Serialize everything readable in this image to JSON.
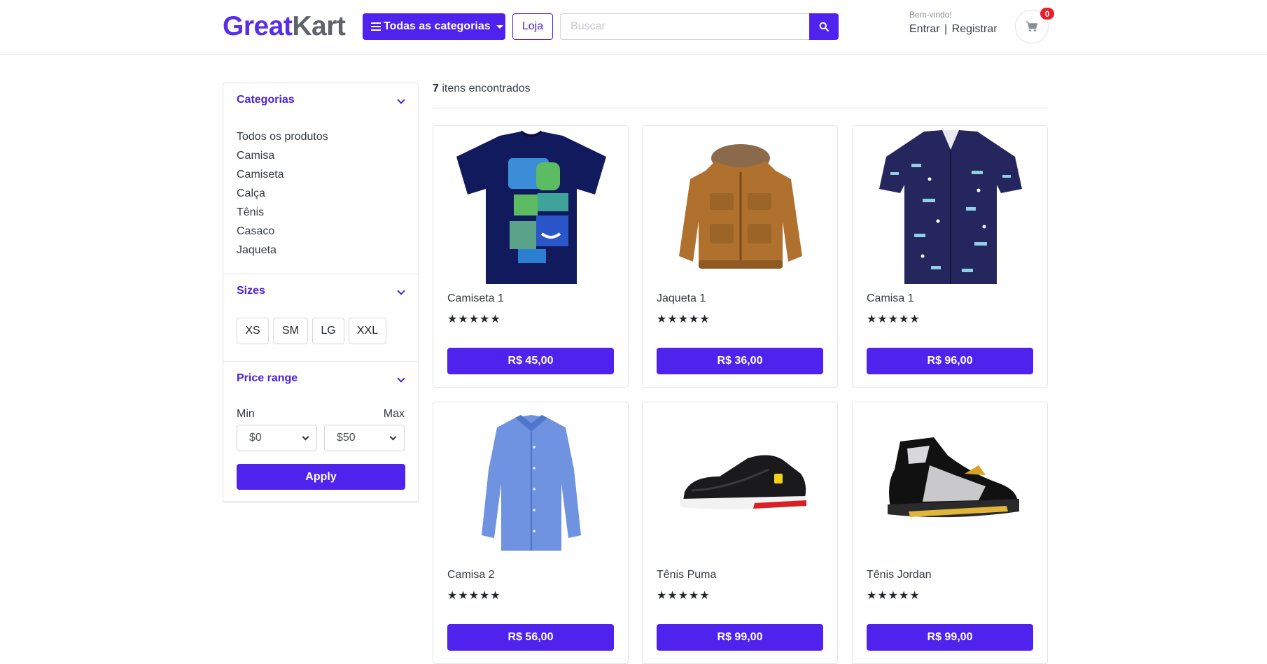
{
  "header": {
    "logo_part1": "Great",
    "logo_part2": "Kart",
    "categories_button": "Todas as categorias",
    "store_button": "Loja",
    "search_placeholder": "Buscar",
    "welcome": "Bem-vindo!",
    "login": "Entrar",
    "separator": "|",
    "register": "Registrar",
    "cart_count": "0"
  },
  "sidebar": {
    "categories": {
      "title": "Categorias",
      "items": [
        "Todos os produtos",
        "Camisa",
        "Camiseta",
        "Calça",
        "Tênis",
        "Casaco",
        "Jaqueta"
      ]
    },
    "sizes": {
      "title": "Sizes",
      "items": [
        "XS",
        "SM",
        "LG",
        "XXL"
      ]
    },
    "price": {
      "title": "Price range",
      "min_label": "Min",
      "max_label": "Max",
      "min_value": "$0",
      "max_value": "$50",
      "apply": "Apply"
    }
  },
  "results": {
    "count": "7",
    "label": "itens encontrados"
  },
  "products": [
    {
      "name": "Camiseta 1",
      "price": "R$ 45,00",
      "rating": 5,
      "icon": "tshirt-image"
    },
    {
      "name": "Jaqueta 1",
      "price": "R$ 36,00",
      "rating": 5,
      "icon": "jacket-image"
    },
    {
      "name": "Camisa 1",
      "price": "R$ 96,00",
      "rating": 5,
      "icon": "shirt-image"
    },
    {
      "name": "Camisa 2",
      "price": "R$ 56,00",
      "rating": 5,
      "icon": "shirt-image"
    },
    {
      "name": "Tênis Puma",
      "price": "R$ 99,00",
      "rating": 5,
      "icon": "sneaker-image"
    },
    {
      "name": "Tênis Jordan",
      "price": "R$ 99,00",
      "rating": 5,
      "icon": "sneaker-image"
    }
  ],
  "colors": {
    "primary": "#5022ee",
    "logo_gray": "#5f6369",
    "badge": "#ee1c2a"
  }
}
